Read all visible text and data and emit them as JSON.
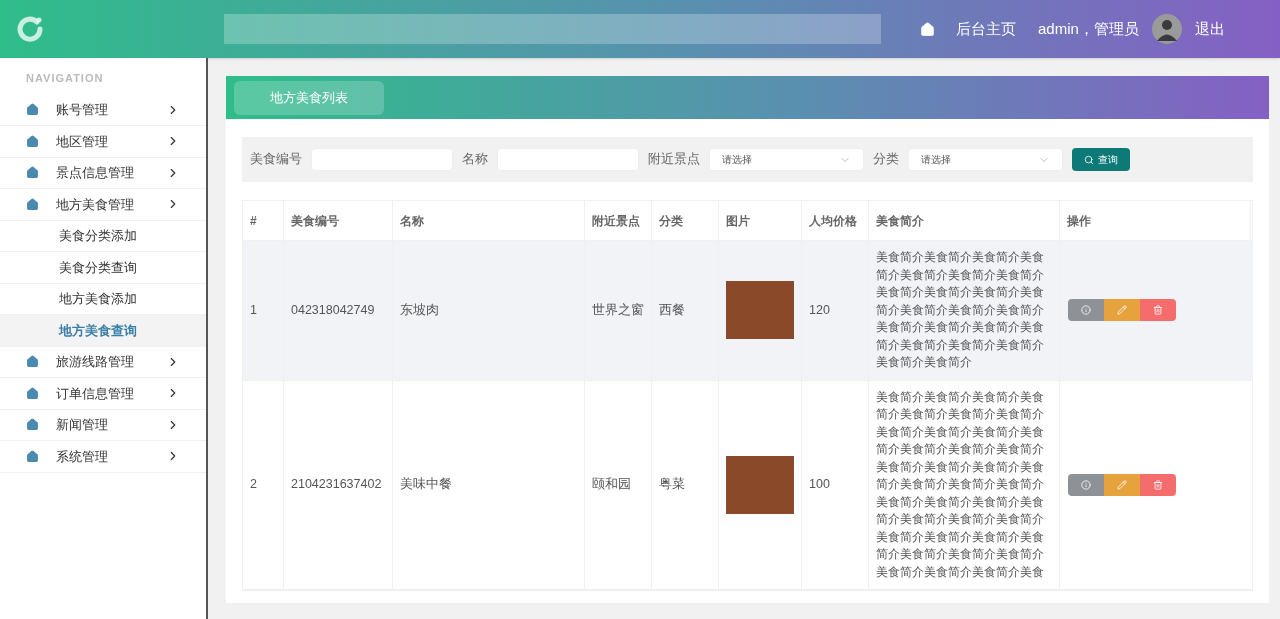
{
  "header": {
    "home_link": "后台主页",
    "user": "admin，管理员",
    "logout": "退出"
  },
  "sidebar": {
    "heading": "NAVIGATION",
    "items": [
      {
        "label": "账号管理"
      },
      {
        "label": "地区管理"
      },
      {
        "label": "景点信息管理"
      },
      {
        "label": "地方美食管理",
        "children": [
          {
            "label": "美食分类添加",
            "selected": false
          },
          {
            "label": "美食分类查询",
            "selected": false
          },
          {
            "label": "地方美食添加",
            "selected": false
          },
          {
            "label": "地方美食查询",
            "selected": true
          }
        ]
      },
      {
        "label": "旅游线路管理"
      },
      {
        "label": "订单信息管理"
      },
      {
        "label": "新闻管理"
      },
      {
        "label": "系统管理"
      }
    ]
  },
  "panel": {
    "title": "地方美食列表",
    "filters": [
      {
        "kind": "text",
        "label": "美食编号"
      },
      {
        "kind": "text",
        "label": "名称"
      },
      {
        "kind": "select",
        "label": "附近景点",
        "placeholder": "请选择"
      },
      {
        "kind": "select",
        "label": "分类",
        "placeholder": "请选择"
      }
    ],
    "search_button": "查询",
    "table": {
      "columns": [
        "#",
        "美食编号",
        "名称",
        "附近景点",
        "分类",
        "图片",
        "人均价格",
        "美食简介",
        "操作"
      ],
      "rows": [
        {
          "highlighted": true,
          "index": "1",
          "code": "042318042749",
          "name": "东坡肉",
          "spot": "世界之窗",
          "category": "西餐",
          "price": "120",
          "description": "美食简介美食简介美食简介美食简介美食简介美食简介美食简介美食简介美食简介美食简介美食简介美食简介美食简介美食简介美食简介美食简介美食简介美食简介美食简介美食简介美食简介美食简介美食简介"
        },
        {
          "highlighted": false,
          "index": "2",
          "code": "2104231637402",
          "name": "美味中餐",
          "spot": "颐和园",
          "category": "粤菜",
          "price": "100",
          "description": "美食简介美食简介美食简介美食简介美食简介美食简介美食简介美食简介美食简介美食简介美食简介美食简介美食简介美食简介美食简介美食简介美食简介美食简介美食简介美食简介美食简介美食简介美食简介美食简介美食简介美食简介美食简介美食简介美食简介美食简介美食简介美食简介美食简介美食简介美食简介美食简介美食简介美食简介美食"
        }
      ]
    }
  }
}
